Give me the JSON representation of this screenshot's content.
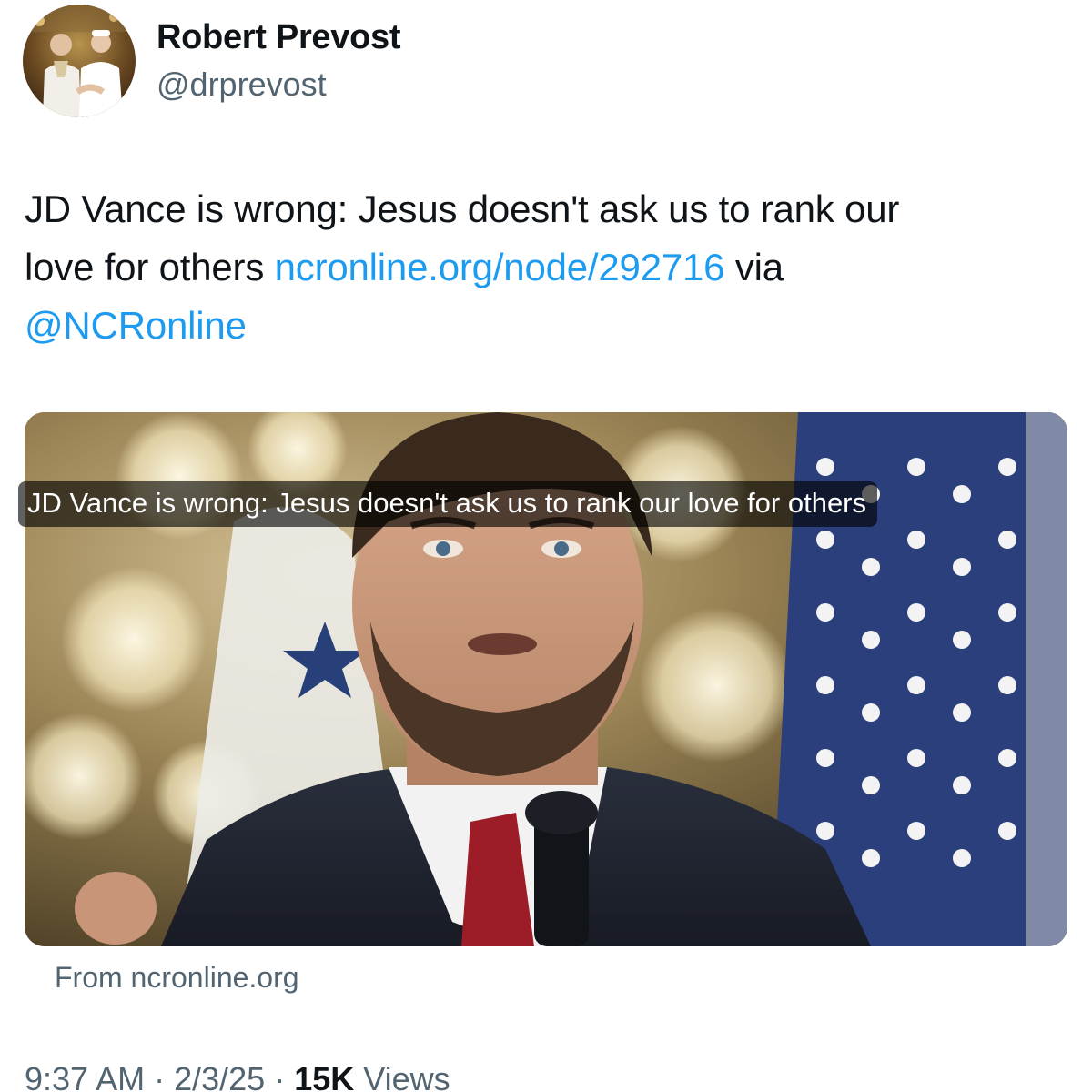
{
  "author": {
    "display_name": "Robert Prevost",
    "handle": "@drprevost",
    "avatar_icon": "profile-photo"
  },
  "tweet": {
    "line1": "JD Vance is wrong: Jesus doesn't ask us to rank our",
    "line2_prefix": "love for others ",
    "link_text": "ncronline.org/node/292716",
    "line2_suffix": " via",
    "mention": "@NCRonline"
  },
  "card": {
    "headline": "JD Vance is wrong: Jesus doesn't ask us to rank our love for others",
    "source": "From ncronline.org",
    "image_icon": "article-photo"
  },
  "meta": {
    "time": "9:37 AM",
    "separator1": " · ",
    "date": "2/3/25",
    "separator2": " · ",
    "views_count": "15K",
    "views_label": " Views"
  },
  "colors": {
    "link": "#1d9bf0",
    "secondary_text": "#536471",
    "primary_text": "#0f1419"
  }
}
